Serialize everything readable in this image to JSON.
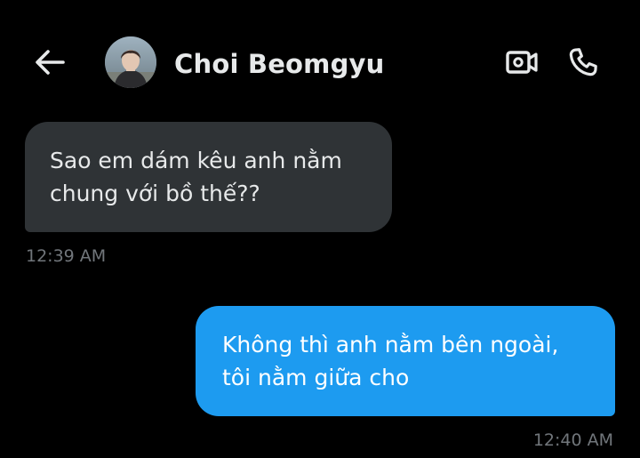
{
  "header": {
    "back_icon": "arrow-left-icon",
    "contact_name": "Choi Beomgyu",
    "video_icon": "video-camera-icon",
    "call_icon": "phone-icon"
  },
  "messages": [
    {
      "direction": "incoming",
      "lines": [
        "Sao em dám kêu anh nằm",
        "chung với bồ thế??"
      ],
      "time": "12:39 AM"
    },
    {
      "direction": "outgoing",
      "lines": [
        "Không thì anh nằm bên ngoài,",
        "tôi nằm giữa cho"
      ],
      "time": "12:40 AM"
    }
  ],
  "colors": {
    "background": "#000000",
    "incoming_bubble": "#2f3336",
    "outgoing_bubble": "#1d9bf0",
    "timestamp": "#71767b",
    "text": "#e7e9ea"
  }
}
